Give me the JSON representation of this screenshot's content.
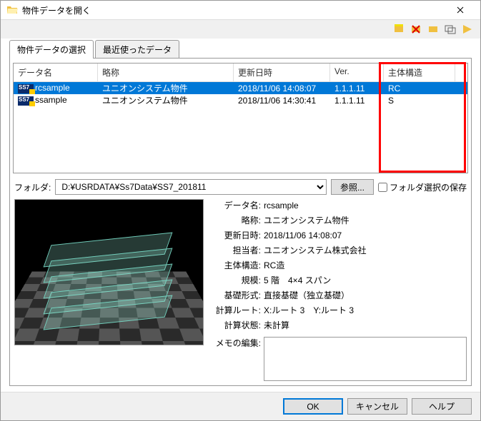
{
  "window": {
    "title": "物件データを開く"
  },
  "tabs": [
    {
      "label": "物件データの選択",
      "active": true
    },
    {
      "label": "最近使ったデータ",
      "active": false
    }
  ],
  "columns": {
    "c1": "データ名",
    "c2": "略称",
    "c3": "更新日時",
    "c4": "Ver.",
    "c5": "主体構造"
  },
  "rows": [
    {
      "name": "rcsample",
      "alias": "ユニオンシステム物件",
      "date": "2018/11/06 14:08:07",
      "ver": "1.1.1.11",
      "struct": "RC",
      "selected": true
    },
    {
      "name": "ssample",
      "alias": "ユニオンシステム物件",
      "date": "2018/11/06 14:30:41",
      "ver": "1.1.1.11",
      "struct": "S",
      "selected": false
    }
  ],
  "folder": {
    "label": "フォルダ:",
    "path": "D:¥USRDATA¥Ss7Data¥SS7_201811",
    "browse": "参照...",
    "save_check": "フォルダ選択の保存"
  },
  "details": {
    "labels": {
      "name": "データ名:",
      "alias": "略称:",
      "date": "更新日時:",
      "person": "担当者:",
      "struct": "主体構造:",
      "scale": "規模:",
      "foundation": "基礎形式:",
      "route": "計算ルート:",
      "status": "計算状態:"
    },
    "values": {
      "name": "rcsample",
      "alias": "ユニオンシステム物件",
      "date": "2018/11/06 14:08:07",
      "person": "ユニオンシステム株式会社",
      "struct": "RC造",
      "scale": "5 階　4×4 スパン",
      "foundation": "直接基礎（独立基礎）",
      "route": "X:ルート 3　Y:ルート 3",
      "status": "未計算"
    }
  },
  "memo": {
    "label": "メモの編集:",
    "value": ""
  },
  "buttons": {
    "ok": "OK",
    "cancel": "キャンセル",
    "help": "ヘルプ"
  }
}
